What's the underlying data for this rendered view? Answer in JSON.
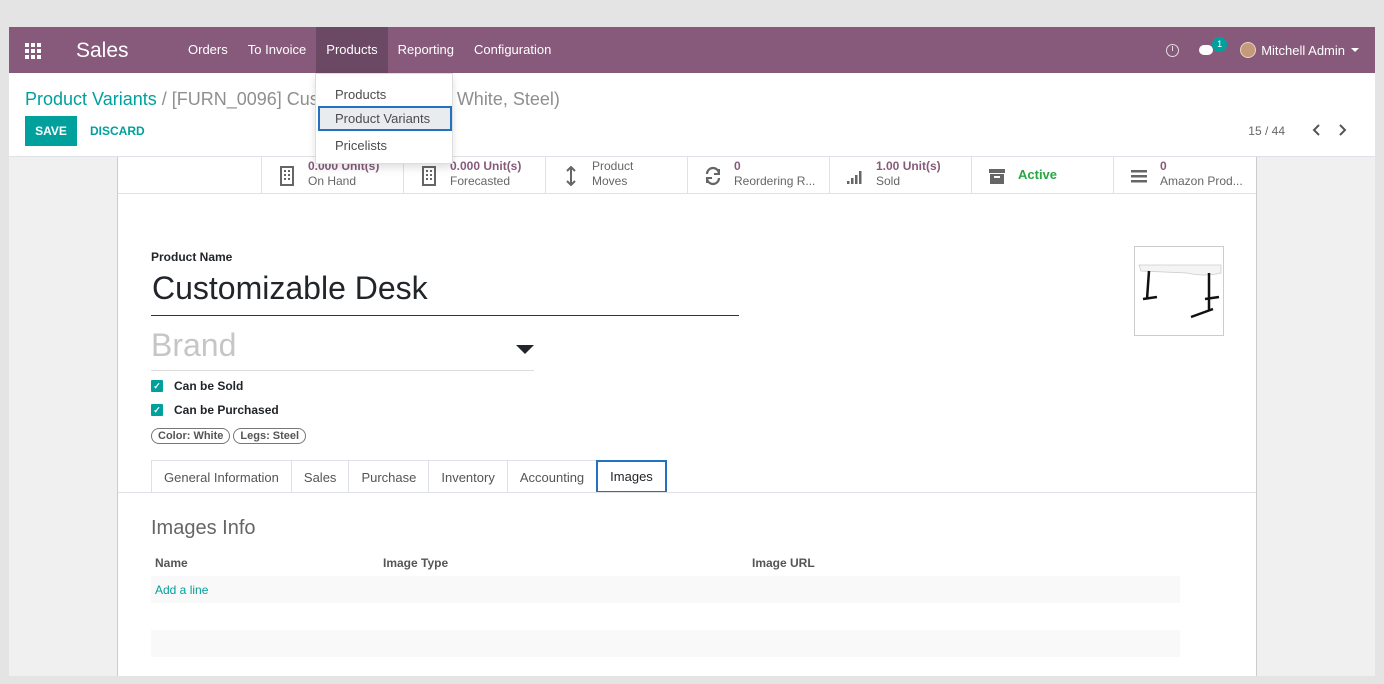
{
  "navbar": {
    "app_name": "Sales",
    "menu": [
      "Orders",
      "To Invoice",
      "Products",
      "Reporting",
      "Configuration"
    ],
    "chat_count": "1",
    "user": "Mitchell Admin",
    "bg_color": "#875a7b"
  },
  "dropdown": {
    "items": [
      "Products",
      "Product Variants",
      "Pricelists"
    ]
  },
  "breadcrumb": {
    "parent": "Product Variants",
    "separator": " / ",
    "current": "[FURN_0096] Cus",
    "current_tail": "White, Steel)"
  },
  "buttons": {
    "save": "SAVE",
    "discard": "DISCARD"
  },
  "pager": {
    "text": "15 / 44"
  },
  "stat_buttons": [
    {
      "value": "0.000 Unit(s)",
      "label": "On Hand",
      "icon": "building-icon"
    },
    {
      "value": "0.000 Unit(s)",
      "label": "Forecasted",
      "icon": "building-icon"
    },
    {
      "value": "Product",
      "label": "Moves",
      "icon": "arrows-v-icon"
    },
    {
      "value": "0",
      "label": "Reordering R...",
      "icon": "refresh-icon"
    },
    {
      "value": "1.00 Unit(s)",
      "label": "Sold",
      "icon": "signal-icon"
    },
    {
      "value": "Active",
      "label": "",
      "icon": "archive-icon"
    },
    {
      "value": "0",
      "label": "Amazon Prod...",
      "icon": "list-icon"
    }
  ],
  "form": {
    "name_label": "Product Name",
    "name": "Customizable Desk",
    "brand_placeholder": "Brand",
    "can_be_sold": "Can be Sold",
    "can_be_purchased": "Can be Purchased",
    "tags": [
      "Color: White",
      "Legs: Steel"
    ]
  },
  "tabs": [
    "General Information",
    "Sales",
    "Purchase",
    "Inventory",
    "Accounting",
    "Images"
  ],
  "images_section": {
    "title": "Images Info",
    "columns": [
      "Name",
      "Image Type",
      "Image URL"
    ],
    "add_line": "Add a line"
  }
}
